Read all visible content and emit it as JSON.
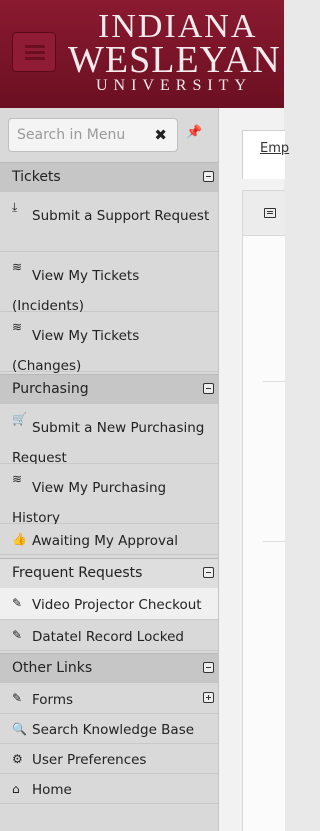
{
  "header": {
    "logo": {
      "line1": "INDIANA",
      "line2": "WESLEYAN",
      "line3": "UNIVERSITY"
    },
    "menu_button_icon": "hamburger-icon"
  },
  "sidebar": {
    "search": {
      "placeholder": "Search in Menu",
      "clear_icon": "close-icon",
      "pin_icon": "pin-icon"
    },
    "sections": [
      {
        "label": "Tickets",
        "items": [
          {
            "label": "Submit a Support Request",
            "icon": "download-icon"
          },
          {
            "label": "View My Tickets (Incidents)",
            "icon": "layers-icon"
          },
          {
            "label": "View My Tickets (Changes)",
            "icon": "layers-icon"
          }
        ]
      },
      {
        "label": "Purchasing",
        "items": [
          {
            "label": "Submit a New Purchasing Request",
            "icon": "cart-icon"
          },
          {
            "label": "View My Purchasing History",
            "icon": "layers-icon"
          },
          {
            "label": "Awaiting My Approval",
            "icon": "thumbs-up-icon"
          }
        ]
      },
      {
        "label": "Frequent Requests",
        "items": [
          {
            "label": "Video Projector Checkout",
            "icon": "edit-icon"
          },
          {
            "label": "Datatel Record Locked",
            "icon": "edit-icon"
          }
        ]
      },
      {
        "label": "Other Links",
        "items": [
          {
            "label": "Forms",
            "icon": "edit-icon"
          },
          {
            "label": "Search Knowledge Base",
            "icon": "search-icon"
          },
          {
            "label": "User Preferences",
            "icon": "gears-icon"
          },
          {
            "label": "Home",
            "icon": "home-icon"
          }
        ]
      }
    ]
  },
  "main": {
    "tab_label": "Emp",
    "panel_icon": "list-icon"
  },
  "colors": {
    "header_bg": "#7a1327",
    "sidebar_bg": "#d9d9d9",
    "section_bg": "#c6c6c6",
    "highlight_bg": "#f0f0f0"
  }
}
